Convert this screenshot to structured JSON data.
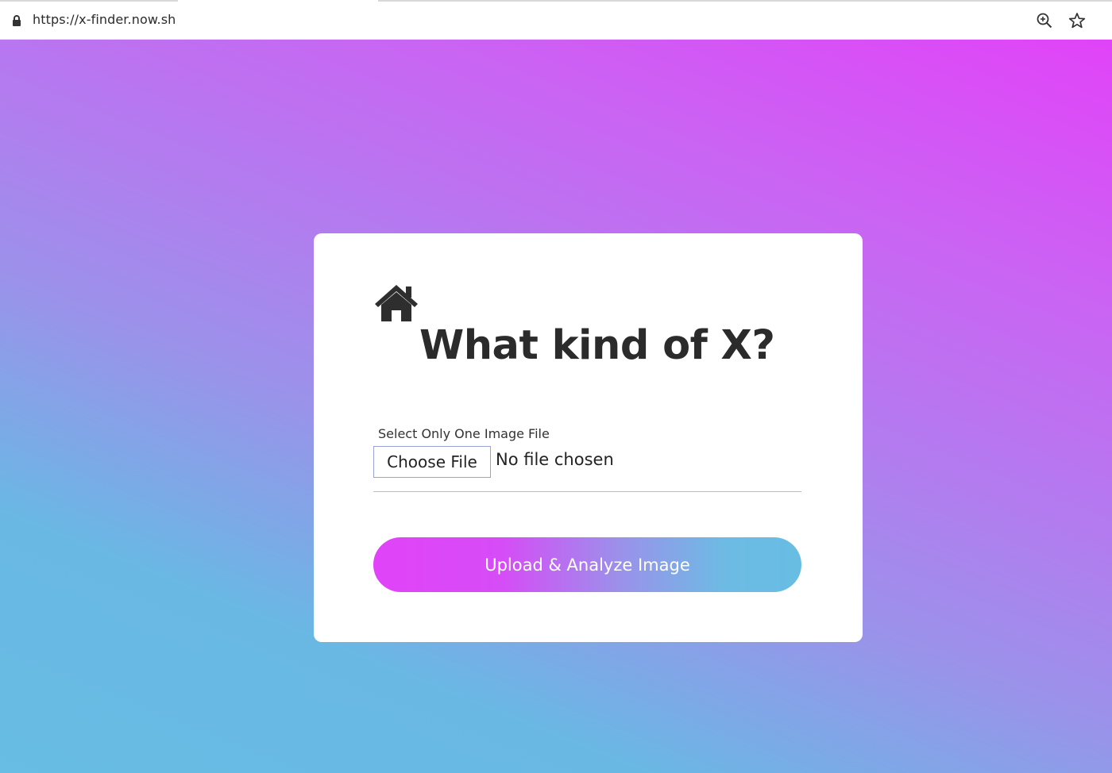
{
  "browser": {
    "url": "https://x-finder.now.sh",
    "icons": {
      "lock": "lock-icon",
      "zoom": "zoom-in-icon",
      "bookmark": "star-icon"
    }
  },
  "card": {
    "home_icon": "home-icon",
    "title": "What kind of X?",
    "file_label": "Select Only One Image File",
    "choose_button": "Choose File",
    "file_status": "No file chosen",
    "submit_button": "Upload & Analyze Image"
  },
  "colors": {
    "gradient_blue": "#67bde3",
    "gradient_magenta": "#e143f8",
    "title_text": "#2b2b2b",
    "card_background": "#ffffff"
  }
}
